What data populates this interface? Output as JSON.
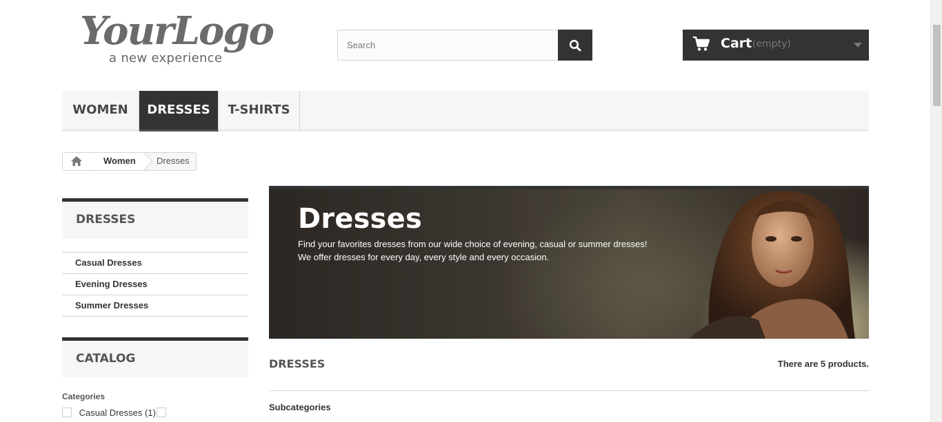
{
  "header": {
    "logo": {
      "script": "YourLogo",
      "tagline": "a new experience"
    },
    "search": {
      "placeholder": "Search"
    },
    "cart": {
      "label": "Cart",
      "status": "(empty)"
    }
  },
  "menu": {
    "items": [
      {
        "label": "WOMEN",
        "active": false
      },
      {
        "label": "DRESSES",
        "active": true
      },
      {
        "label": "T-SHIRTS",
        "active": false
      }
    ]
  },
  "breadcrumb": {
    "parent": "Women",
    "current": "Dresses"
  },
  "sidebar": {
    "dresses_block": {
      "title": "DRESSES",
      "items": [
        "Casual Dresses",
        "Evening Dresses",
        "Summer Dresses"
      ]
    },
    "catalog_block": {
      "title": "CATALOG",
      "filter_label": "Categories",
      "filters": [
        {
          "label": "Casual Dresses",
          "count": "(1)"
        }
      ]
    }
  },
  "banner": {
    "title": "Dresses",
    "line1": "Find your favorites dresses from our wide choice of evening, casual or summer dresses!",
    "line2": "We offer dresses for every day, every style and every occasion."
  },
  "listing": {
    "title": "DRESSES",
    "count_text": "There are 5 products.",
    "subcategories_label": "Subcategories"
  },
  "colors": {
    "dark": "#333333",
    "menu_bg": "#f6f6f6",
    "border": "#d6d4d4"
  }
}
